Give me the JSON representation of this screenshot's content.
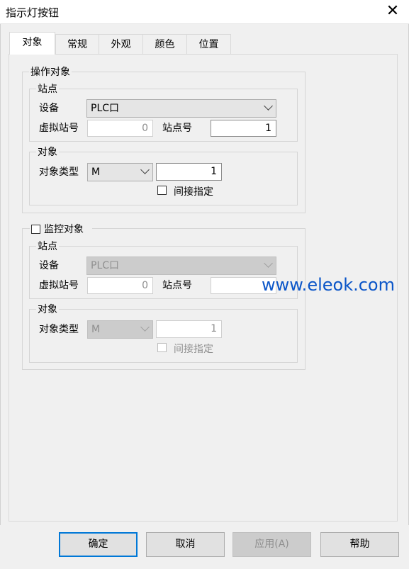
{
  "window": {
    "title": "指示灯按钮",
    "close_glyph": "✕"
  },
  "tabs": [
    {
      "label": "对象",
      "active": true
    },
    {
      "label": "常规",
      "active": false
    },
    {
      "label": "外观",
      "active": false
    },
    {
      "label": "颜色",
      "active": false
    },
    {
      "label": "位置",
      "active": false
    }
  ],
  "operate": {
    "title": "操作对象",
    "station_group": "站点",
    "device_label": "设备",
    "device_value": "PLC口",
    "virtual_station_label": "虚拟站号",
    "virtual_station_value": "0",
    "station_no_label": "站点号",
    "station_no_value": "1",
    "object_group": "对象",
    "object_type_label": "对象类型",
    "object_type_value": "M",
    "address_value": "1",
    "indirect_label": "间接指定",
    "indirect_checked": false
  },
  "monitor": {
    "title": "监控对象",
    "checked": false,
    "station_group": "站点",
    "device_label": "设备",
    "device_value": "PLC口",
    "virtual_station_label": "虚拟站号",
    "virtual_station_value": "0",
    "station_no_label": "站点号",
    "station_no_value": "",
    "object_group": "对象",
    "object_type_label": "对象类型",
    "object_type_value": "M",
    "address_value": "1",
    "indirect_label": "间接指定",
    "indirect_checked": false
  },
  "watermark": "www.eleok.com",
  "buttons": {
    "ok": "确定",
    "cancel": "取消",
    "apply": "应用(A)",
    "help": "帮助"
  },
  "colors": {
    "accent": "#0078d7",
    "watermark": "#0a55c8"
  }
}
